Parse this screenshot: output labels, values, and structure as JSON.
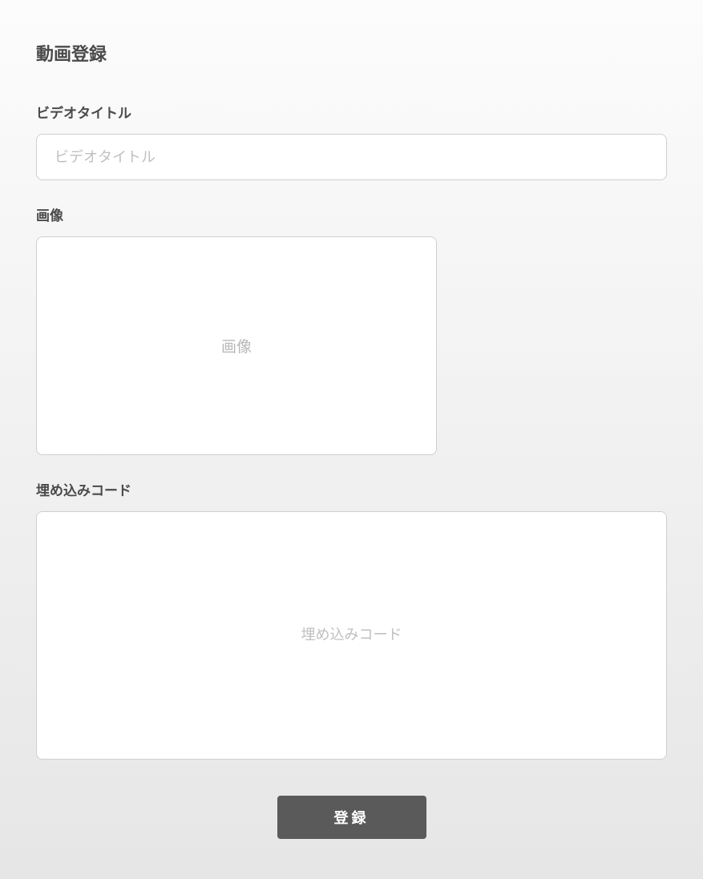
{
  "page": {
    "title": "動画登録"
  },
  "form": {
    "video_title": {
      "label": "ビデオタイトル",
      "placeholder": "ビデオタイトル",
      "value": ""
    },
    "image": {
      "label": "画像",
      "placeholder": "画像"
    },
    "embed_code": {
      "label": "埋め込みコード",
      "placeholder": "埋め込みコード",
      "value": ""
    },
    "submit_label": "登録"
  }
}
